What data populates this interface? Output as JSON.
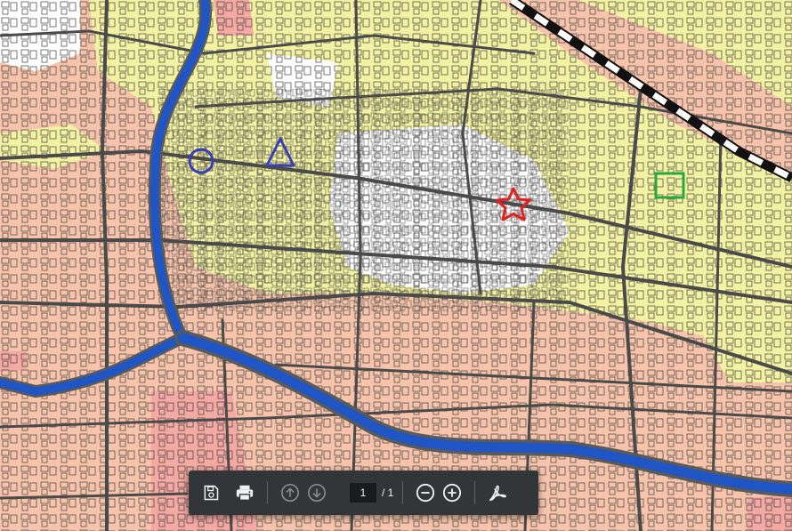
{
  "map": {
    "markers": [
      {
        "shape": "circle",
        "color": "#3a3fb8",
        "name": "circle-marker"
      },
      {
        "shape": "triangle",
        "color": "#3a3fb8",
        "name": "triangle-marker"
      },
      {
        "shape": "star",
        "color": "#e32020",
        "name": "star-marker"
      },
      {
        "shape": "square",
        "color": "#26a83a",
        "name": "square-marker"
      }
    ],
    "colors": {
      "base": "#f7c4ab",
      "yellow_zone": "#f3f2a2",
      "white_zone": "#ffffff",
      "pink_zone": "#f5a9a3",
      "river": "#1f55c4",
      "road": "#4a4a4a",
      "railway": "#000000"
    }
  },
  "toolbar": {
    "save_icon": "save-icon",
    "print_icon": "print-icon",
    "prev_icon": "arrow-up-icon",
    "next_icon": "arrow-down-icon",
    "page_value": "1",
    "page_total": "/ 1",
    "zoom_out_icon": "zoom-out-icon",
    "zoom_in_icon": "zoom-in-icon",
    "acrobat_icon": "acrobat-icon",
    "background": "#323639"
  }
}
